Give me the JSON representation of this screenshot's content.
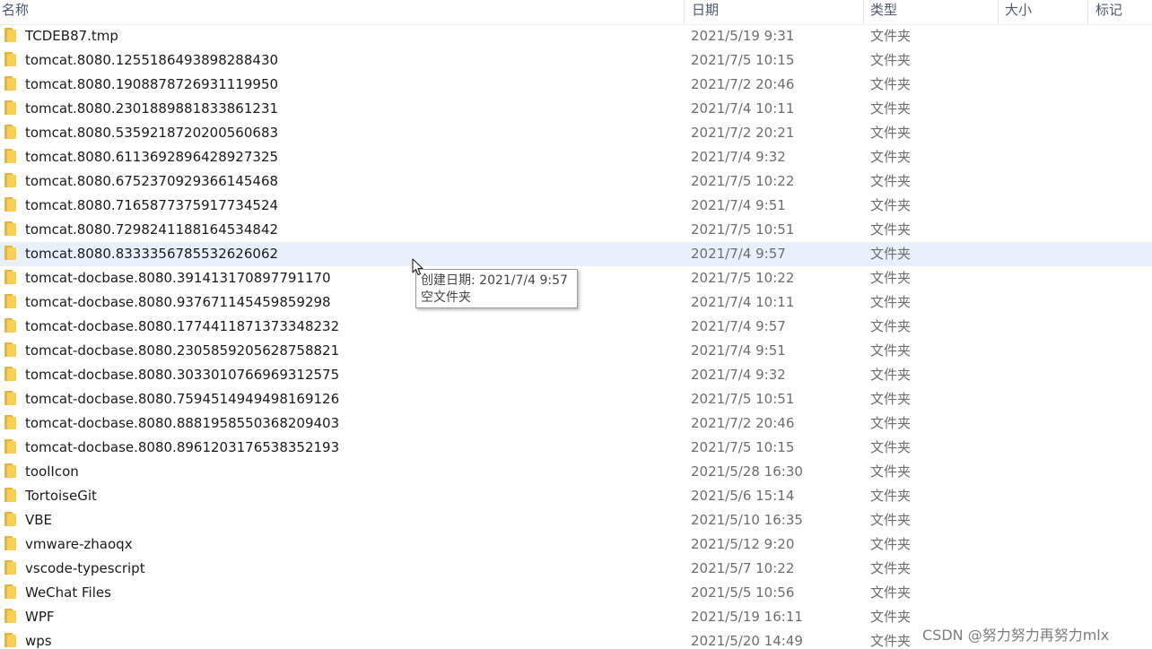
{
  "columns": {
    "name": "名称",
    "date": "日期",
    "type": "类型",
    "size": "大小",
    "tag": "标记"
  },
  "rows": [
    {
      "name": "TCDEB87.tmp",
      "date": "2021/5/19 9:31",
      "type": "文件夹"
    },
    {
      "name": "tomcat.8080.1255186493898288430",
      "date": "2021/7/5 10:15",
      "type": "文件夹"
    },
    {
      "name": "tomcat.8080.1908878726931119950",
      "date": "2021/7/2 20:46",
      "type": "文件夹"
    },
    {
      "name": "tomcat.8080.2301889881833861231",
      "date": "2021/7/4 10:11",
      "type": "文件夹"
    },
    {
      "name": "tomcat.8080.5359218720200560683",
      "date": "2021/7/2 20:21",
      "type": "文件夹"
    },
    {
      "name": "tomcat.8080.6113692896428927325",
      "date": "2021/7/4 9:32",
      "type": "文件夹"
    },
    {
      "name": "tomcat.8080.6752370929366145468",
      "date": "2021/7/5 10:22",
      "type": "文件夹"
    },
    {
      "name": "tomcat.8080.7165877375917734524",
      "date": "2021/7/4 9:51",
      "type": "文件夹"
    },
    {
      "name": "tomcat.8080.7298241188164534842",
      "date": "2021/7/5 10:51",
      "type": "文件夹"
    },
    {
      "name": "tomcat.8080.8333356785532626062",
      "date": "2021/7/4 9:57",
      "type": "文件夹"
    },
    {
      "name": "tomcat-docbase.8080.391413170897791170",
      "date": "2021/7/5 10:22",
      "type": "文件夹"
    },
    {
      "name": "tomcat-docbase.8080.937671145459859298",
      "date": "2021/7/4 10:11",
      "type": "文件夹"
    },
    {
      "name": "tomcat-docbase.8080.1774411871373348232",
      "date": "2021/7/4 9:57",
      "type": "文件夹"
    },
    {
      "name": "tomcat-docbase.8080.2305859205628758821",
      "date": "2021/7/4 9:51",
      "type": "文件夹"
    },
    {
      "name": "tomcat-docbase.8080.3033010766969312575",
      "date": "2021/7/4 9:32",
      "type": "文件夹"
    },
    {
      "name": "tomcat-docbase.8080.7594514949498169126",
      "date": "2021/7/5 10:51",
      "type": "文件夹"
    },
    {
      "name": "tomcat-docbase.8080.8881958550368209403",
      "date": "2021/7/2 20:46",
      "type": "文件夹"
    },
    {
      "name": "tomcat-docbase.8080.8961203176538352193",
      "date": "2021/7/5 10:15",
      "type": "文件夹"
    },
    {
      "name": "toolIcon",
      "date": "2021/5/28 16:30",
      "type": "文件夹"
    },
    {
      "name": "TortoiseGit",
      "date": "2021/5/6 15:14",
      "type": "文件夹"
    },
    {
      "name": "VBE",
      "date": "2021/5/10 16:35",
      "type": "文件夹"
    },
    {
      "name": "vmware-zhaoqx",
      "date": "2021/5/12 9:20",
      "type": "文件夹"
    },
    {
      "name": "vscode-typescript",
      "date": "2021/5/7 10:22",
      "type": "文件夹"
    },
    {
      "name": "WeChat Files",
      "date": "2021/5/5 10:56",
      "type": "文件夹"
    },
    {
      "name": "WPF",
      "date": "2021/5/19 16:11",
      "type": "文件夹"
    },
    {
      "name": "wps",
      "date": "2021/5/20 14:49",
      "type": "文件夹"
    }
  ],
  "hover_row": 9,
  "tooltip": {
    "line1": "创建日期: 2021/7/4 9:57",
    "line2": "空文件夹"
  },
  "watermark": "CSDN @努力努力再努力mlx",
  "colors": {
    "hover_background": "#e8f1fb",
    "folder_front": "#f8cf5b",
    "folder_back": "#e7b43a"
  },
  "icons": {
    "row_icon": "folder-icon",
    "pointer": "mouse-cursor-icon"
  }
}
